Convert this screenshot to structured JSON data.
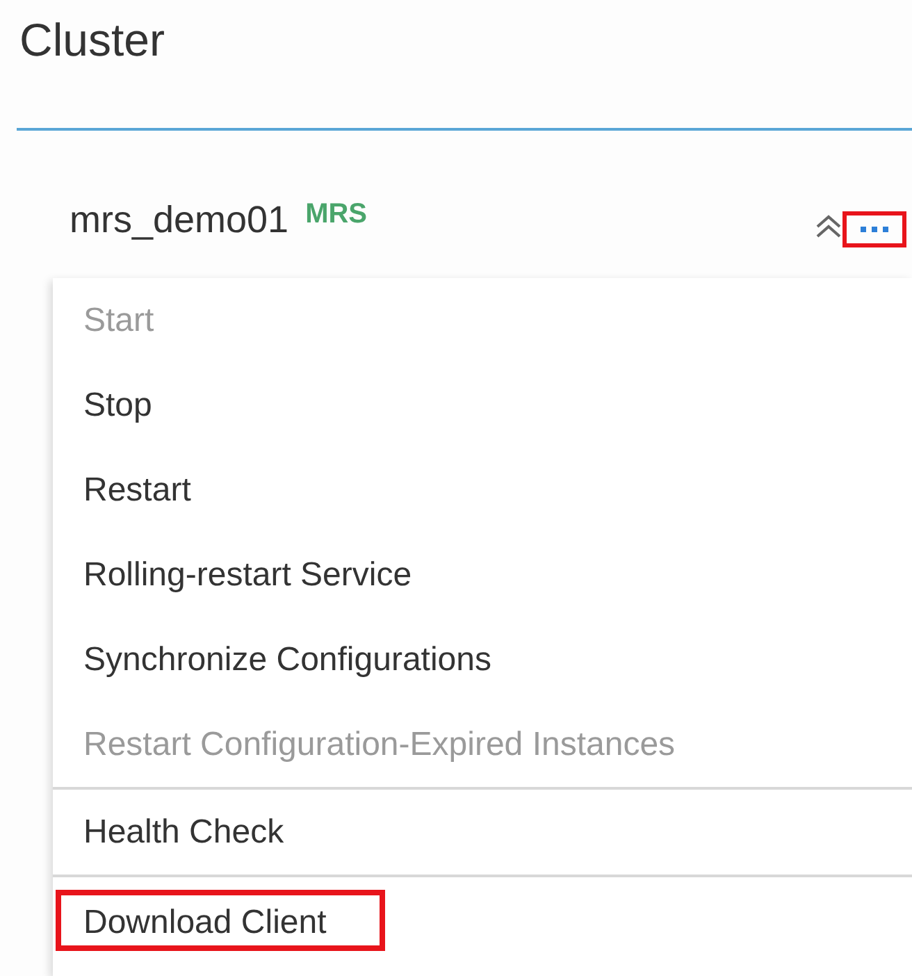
{
  "page": {
    "title": "Cluster"
  },
  "cluster": {
    "name": "mrs_demo01",
    "tag": "MRS",
    "more_highlighted": true
  },
  "menu": {
    "groups": [
      [
        {
          "label": "Start",
          "disabled": true,
          "highlighted": false
        },
        {
          "label": "Stop",
          "disabled": false,
          "highlighted": false
        },
        {
          "label": "Restart",
          "disabled": false,
          "highlighted": false
        },
        {
          "label": "Rolling-restart Service",
          "disabled": false,
          "highlighted": false
        },
        {
          "label": "Synchronize Configurations",
          "disabled": false,
          "highlighted": false
        },
        {
          "label": "Restart Configuration-Expired Instances",
          "disabled": true,
          "highlighted": false
        }
      ],
      [
        {
          "label": "Health Check",
          "disabled": false,
          "highlighted": false
        }
      ],
      [
        {
          "label": "Download Client",
          "disabled": false,
          "highlighted": true
        }
      ]
    ]
  }
}
